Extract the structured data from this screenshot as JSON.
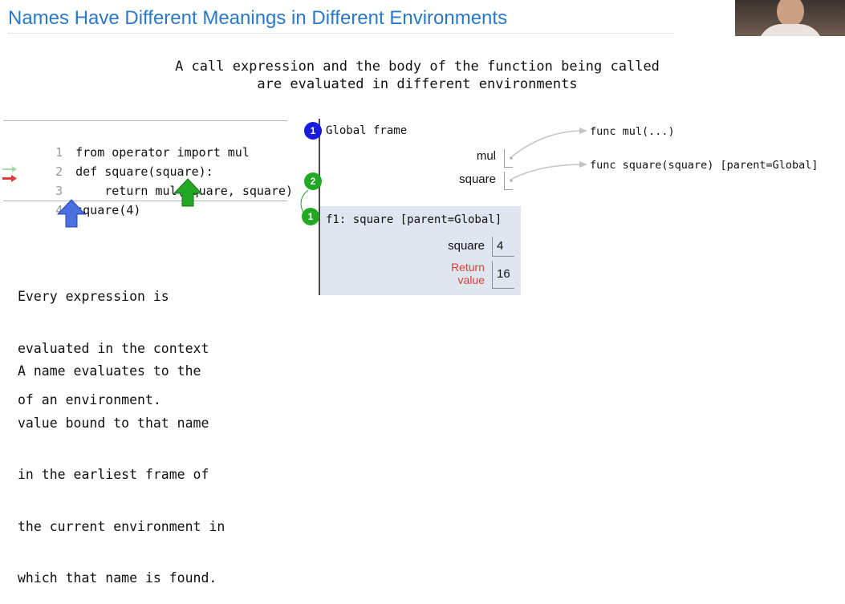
{
  "slide": {
    "title": "Names Have Different Meanings in Different Environments",
    "subtitle_lines": [
      "A call expression and the body of the function being called",
      "are evaluated in different environments"
    ]
  },
  "code": {
    "lines": [
      {
        "num": "1",
        "text": "from operator import mul"
      },
      {
        "num": "2",
        "text": "def square(square):"
      },
      {
        "num": "3",
        "text": "    return mul(square, square)"
      },
      {
        "num": "4",
        "text": "square(4)"
      }
    ],
    "current_line": "3"
  },
  "explanation": {
    "para1": [
      "Every expression is",
      "evaluated in the context",
      "of an environment."
    ],
    "para2": [
      "A name evaluates to the",
      "value bound to that name",
      "in the earliest frame of",
      "the current environment in",
      "which that name is found."
    ]
  },
  "diagram": {
    "global_frame": {
      "badge": "1",
      "title": "Global frame",
      "bindings": [
        {
          "name": "mul"
        },
        {
          "name": "square"
        }
      ],
      "call_badge": "2"
    },
    "f1_frame": {
      "badge": "1",
      "title": "f1: square [parent=Global]",
      "bindings": [
        {
          "name": "square",
          "value": "4"
        }
      ],
      "return_label_line1": "Return",
      "return_label_line2": "value",
      "return_value": "16"
    },
    "objects": [
      {
        "label": "func mul(...)"
      },
      {
        "label": "func square(square) [parent=Global]"
      }
    ]
  },
  "colors": {
    "title": "#2a78c8",
    "badge_blue": "#1a1ae0",
    "badge_green": "#22a822",
    "arrow_blue": "#4a6fe0",
    "arrow_green": "#22a822",
    "return_label": "#e03c3c",
    "frame_bg": "#dfe6ef"
  }
}
